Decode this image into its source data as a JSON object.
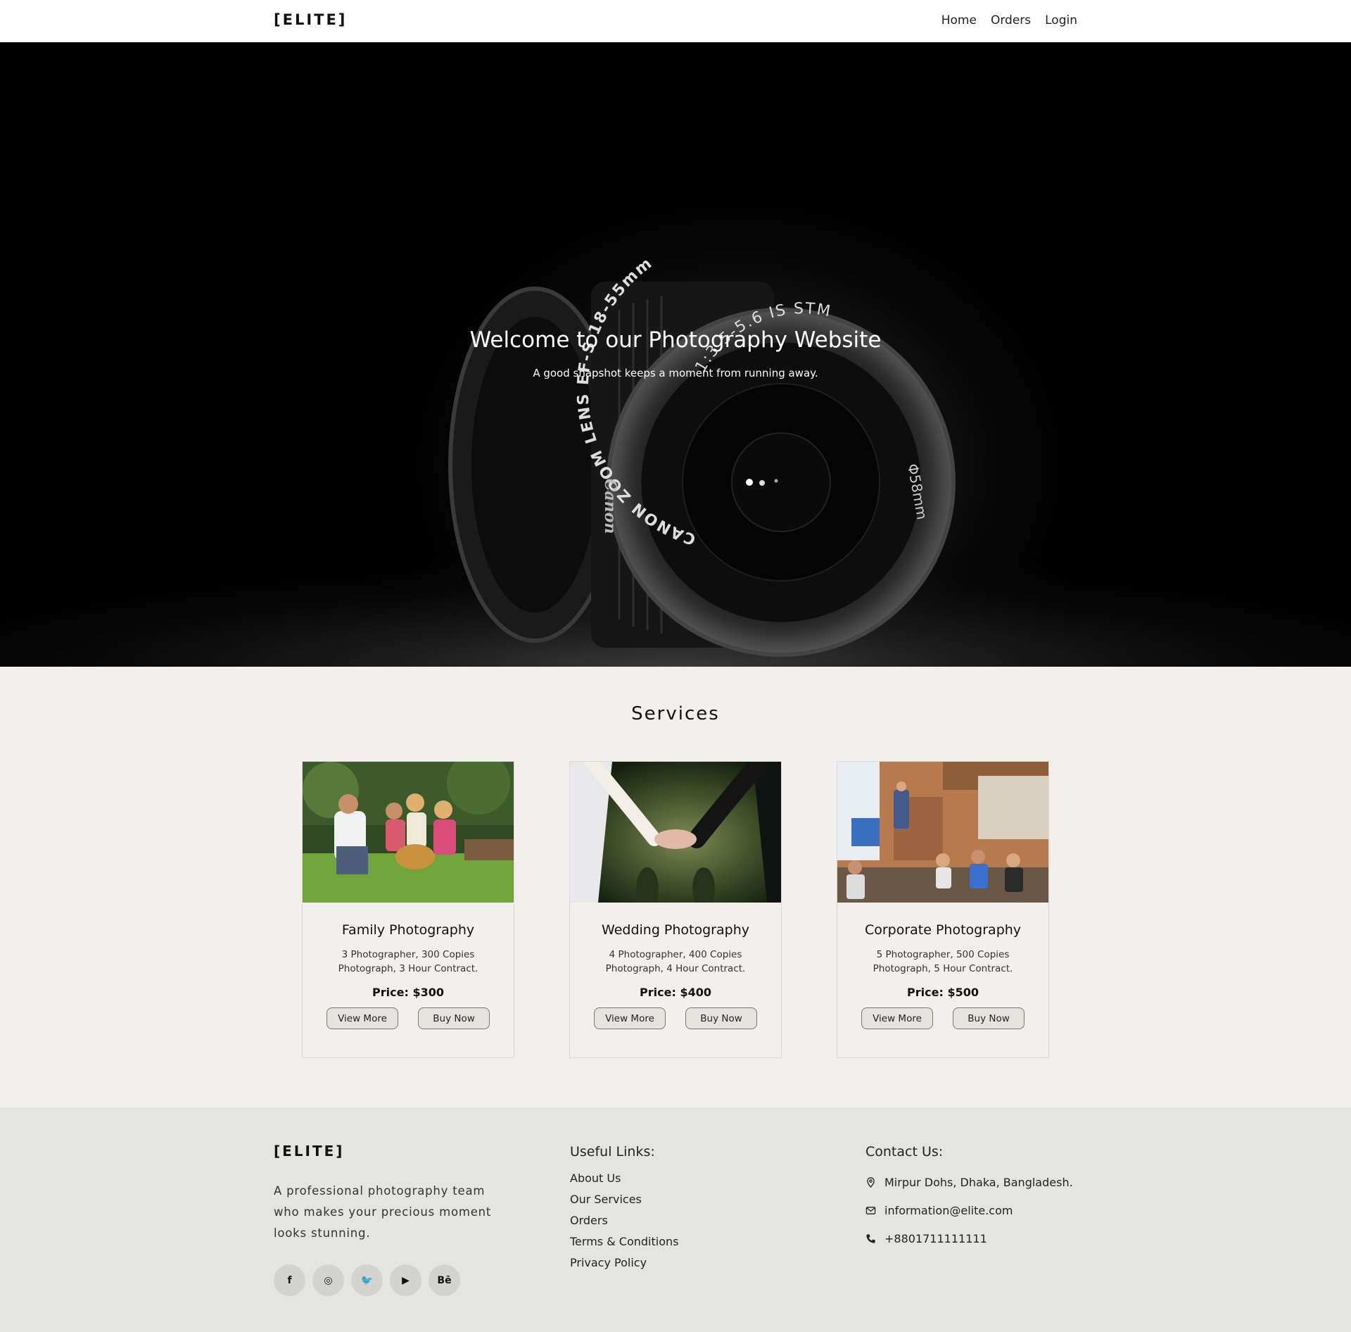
{
  "nav": {
    "logo": "[ELITE]",
    "links": [
      "Home",
      "Orders",
      "Login"
    ]
  },
  "hero": {
    "title": "Welcome to our Photography Website",
    "subtitle": "A good snapshot keeps a moment from running away.",
    "lens_text_outer": "CANON ZOOM LENS EF-S 18-55mm",
    "lens_text_inner": "1:3.5-5.6 IS STM",
    "lens_text_side": "Φ58mm",
    "lens_brand": "Canon"
  },
  "services": {
    "title": "Services",
    "cards": [
      {
        "title": "Family Photography",
        "desc": "3 Photographer, 300 Copies Photograph, 3 Hour Contract.",
        "price": "Price: $300",
        "view": "View More",
        "buy": "Buy Now"
      },
      {
        "title": "Wedding Photography",
        "desc": "4 Photographer, 400 Copies Photograph, 4 Hour Contract.",
        "price": "Price: $400",
        "view": "View More",
        "buy": "Buy Now"
      },
      {
        "title": "Corporate Photography",
        "desc": "5 Photographer, 500 Copies Photograph, 5 Hour Contract.",
        "price": "Price: $500",
        "view": "View More",
        "buy": "Buy Now"
      }
    ]
  },
  "footer": {
    "logo": "[ELITE]",
    "about": "A professional photography team who makes your precious moment looks stunning.",
    "social": [
      {
        "icon": "facebook-icon",
        "glyph": "f"
      },
      {
        "icon": "instagram-icon",
        "glyph": "◎"
      },
      {
        "icon": "twitter-icon",
        "glyph": "🐦"
      },
      {
        "icon": "youtube-icon",
        "glyph": "▶"
      },
      {
        "icon": "behance-icon",
        "glyph": "Bē"
      }
    ],
    "links_title": "Useful Links:",
    "links": [
      "About Us",
      "Our Services",
      "Orders",
      "Terms & Conditions",
      "Privacy Policy"
    ],
    "contact_title": "Contact Us:",
    "address": "Mirpur Dohs, Dhaka, Bangladesh.",
    "email": "information@elite.com",
    "phone": "+8801711111111"
  }
}
